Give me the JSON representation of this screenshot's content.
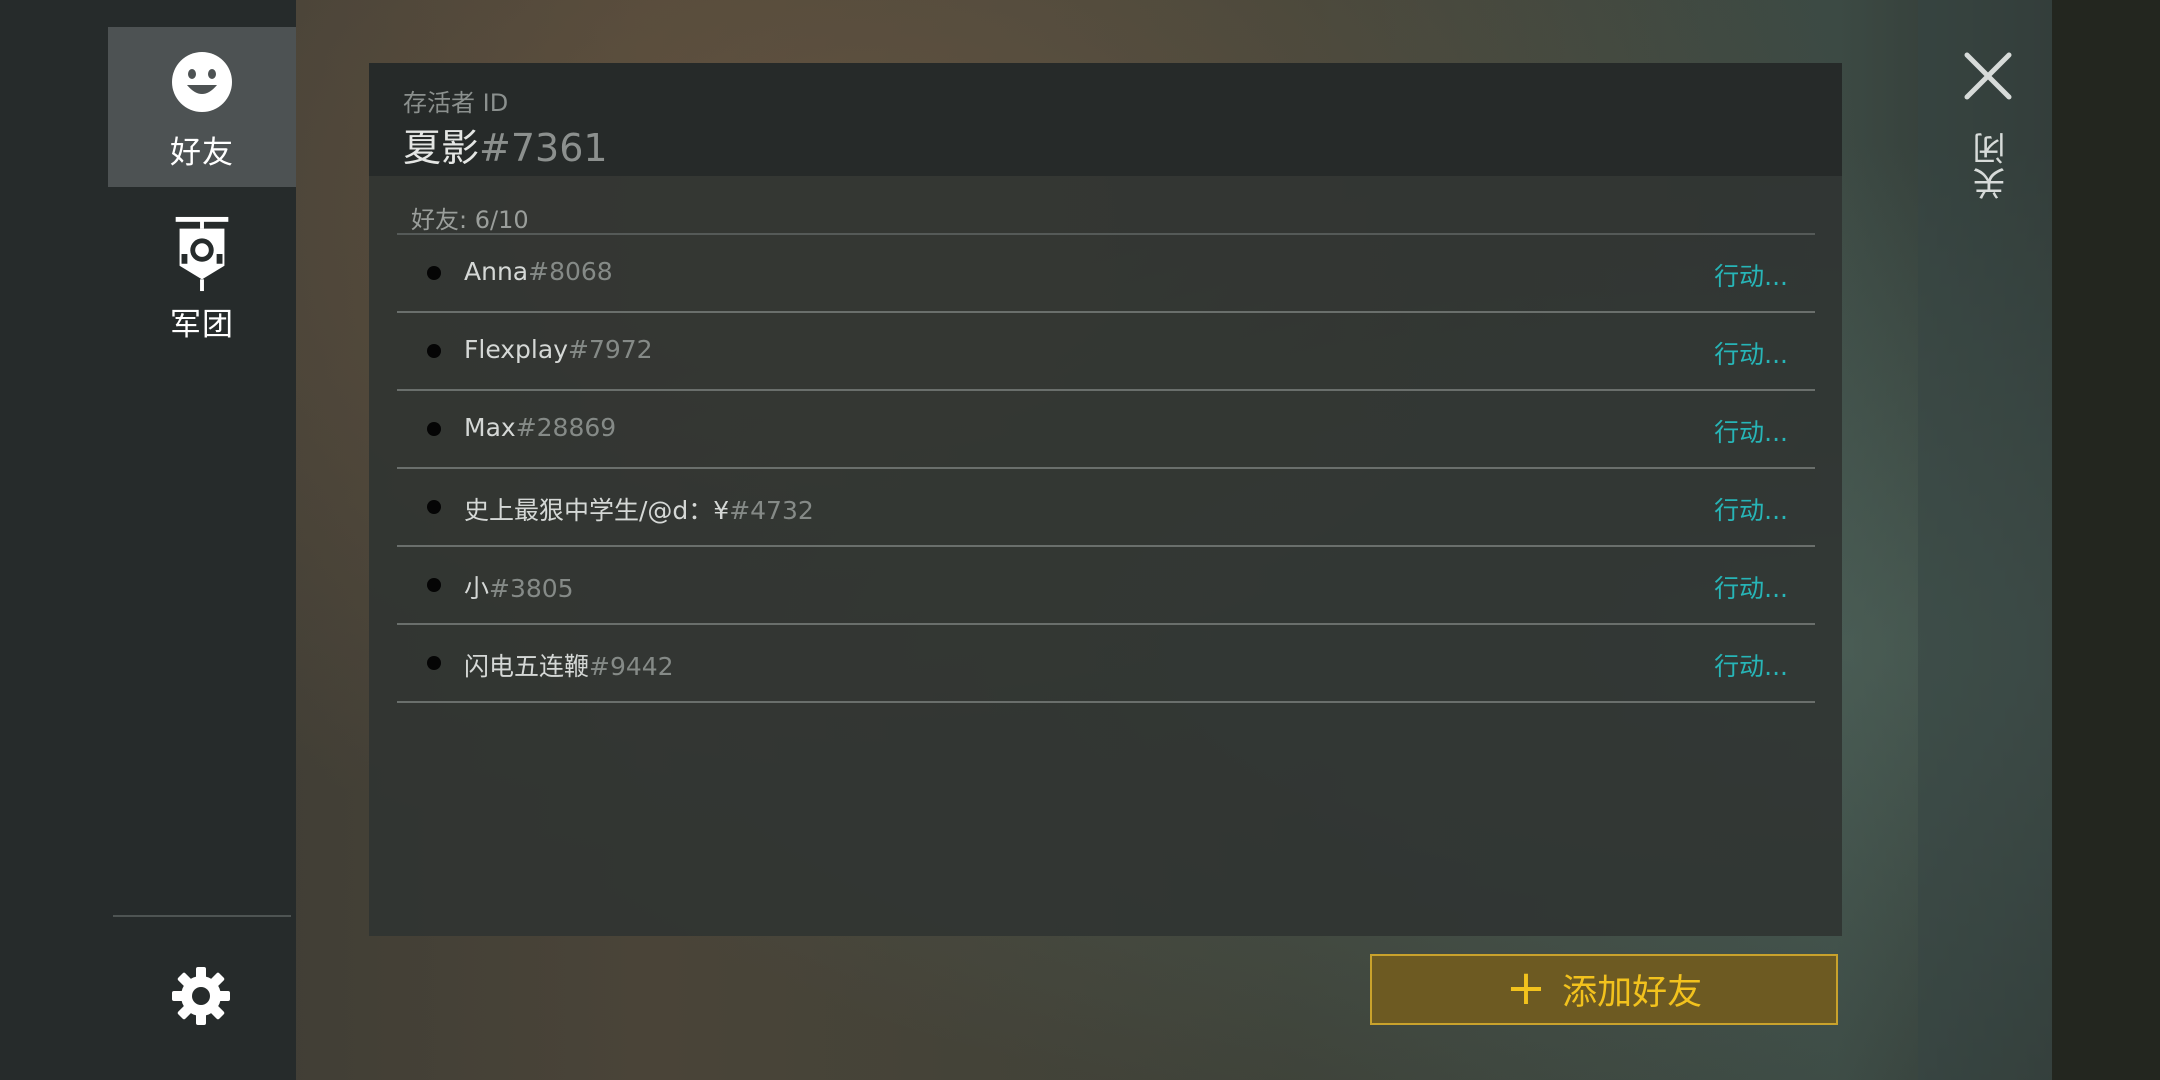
{
  "sidebar": {
    "items": [
      {
        "label": "好友",
        "icon": "smiley-icon",
        "active": true
      },
      {
        "label": "军团",
        "icon": "banner-icon",
        "active": false
      }
    ],
    "settings_icon": "gear-icon"
  },
  "panel": {
    "survivor_label": "存活者 ID",
    "survivor_name": "夏影",
    "survivor_tag": "#7361",
    "friends_count": "好友: 6/10",
    "friends": [
      {
        "name": "Anna",
        "tag": "#8068",
        "action": "行动..."
      },
      {
        "name": "Flexplay",
        "tag": "#7972",
        "action": "行动..."
      },
      {
        "name": "Max",
        "tag": "#28869",
        "action": "行动..."
      },
      {
        "name": "史上最狠中学生/@d：¥",
        "tag": "#4732",
        "action": "行动..."
      },
      {
        "name": "小",
        "tag": "#3805",
        "action": "行动..."
      },
      {
        "name": "闪电五连鞭",
        "tag": "#9442",
        "action": "行动..."
      }
    ]
  },
  "add_friend": {
    "label": "添加好友",
    "plus": "+"
  },
  "close": {
    "label": "关闭",
    "icon": "close-icon"
  },
  "colors": {
    "accent": "#27b5b7",
    "button_text": "#f2c21d",
    "button_bg": "#6d5a22"
  }
}
